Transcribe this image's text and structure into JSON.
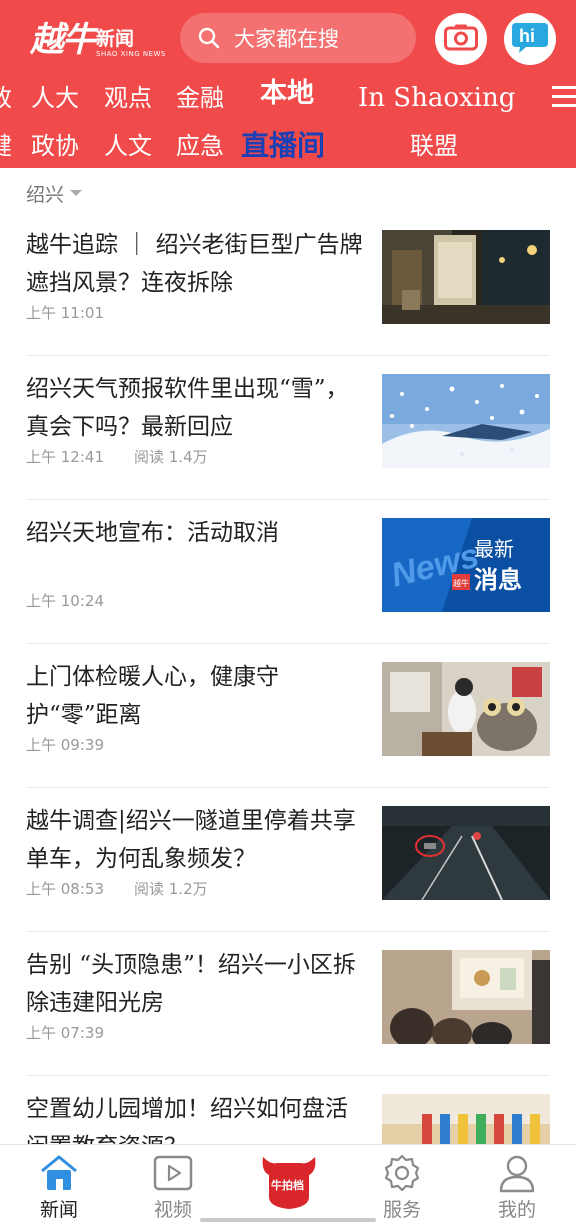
{
  "header": {
    "logo_main": "越牛",
    "logo_news": "新闻",
    "logo_sub": "SHAO XING NEWS",
    "search_placeholder": "大家都在搜",
    "hi_label": "hi"
  },
  "tabs_row1": [
    {
      "label": "政"
    },
    {
      "label": "人大"
    },
    {
      "label": "观点"
    },
    {
      "label": "金融"
    },
    {
      "label": "本地"
    },
    {
      "label": "In Shaoxing"
    }
  ],
  "tabs_row2": [
    {
      "label": "健"
    },
    {
      "label": "政协"
    },
    {
      "label": "人文"
    },
    {
      "label": "应急"
    },
    {
      "label": "直播间"
    },
    {
      "label": "联盟"
    }
  ],
  "region": {
    "label": "绍兴"
  },
  "articles": [
    {
      "title": "越牛追踪 ｜ 绍兴老街巨型广告牌遮挡风景？连夜拆除",
      "time": "上午 11:01",
      "reads": "",
      "thumb": "street-night"
    },
    {
      "title": "绍兴天气预报软件里出现“雪”，真会下吗？最新回应",
      "time": "上午 12:41",
      "reads": "阅读 1.4万",
      "thumb": "snow"
    },
    {
      "title": "绍兴天地宣布：活动取消",
      "time": "上午 10:24",
      "reads": "",
      "thumb": "news-banner",
      "thumb_text_1": "最新",
      "thumb_text_2": "消息",
      "thumb_bg_text": "News",
      "thumb_badge": "越牛"
    },
    {
      "title": "上门体检暖人心，健康守护“零”距离",
      "time": "上午 09:39",
      "reads": "",
      "thumb": "home-visit"
    },
    {
      "title": "越牛调查|绍兴一隧道里停着共享单车，为何乱象频发？",
      "time": "上午 08:53",
      "reads": "阅读 1.2万",
      "thumb": "tunnel"
    },
    {
      "title": "告别 “头顶隐患”！绍兴一小区拆除违建阳光房",
      "time": "上午 07:39",
      "reads": "",
      "thumb": "meeting"
    },
    {
      "title": "空置幼儿园增加！绍兴如何盘活闲置教育资源？",
      "time": "",
      "reads": "",
      "thumb": "toys"
    }
  ],
  "bottom_nav": [
    {
      "label": "新闻",
      "icon": "house-icon",
      "active": true
    },
    {
      "label": "视频",
      "icon": "video-icon",
      "active": false
    },
    {
      "label": "",
      "icon": "bull-logo-icon",
      "active": false,
      "logo_text": "牛拍档"
    },
    {
      "label": "服务",
      "icon": "gear-icon",
      "active": false
    },
    {
      "label": "我的",
      "icon": "user-icon",
      "active": false
    }
  ],
  "colors": {
    "brand_red": "#f04a4a",
    "active_tab": "#1b3fb5",
    "nav_active": "#2f8fe0"
  }
}
